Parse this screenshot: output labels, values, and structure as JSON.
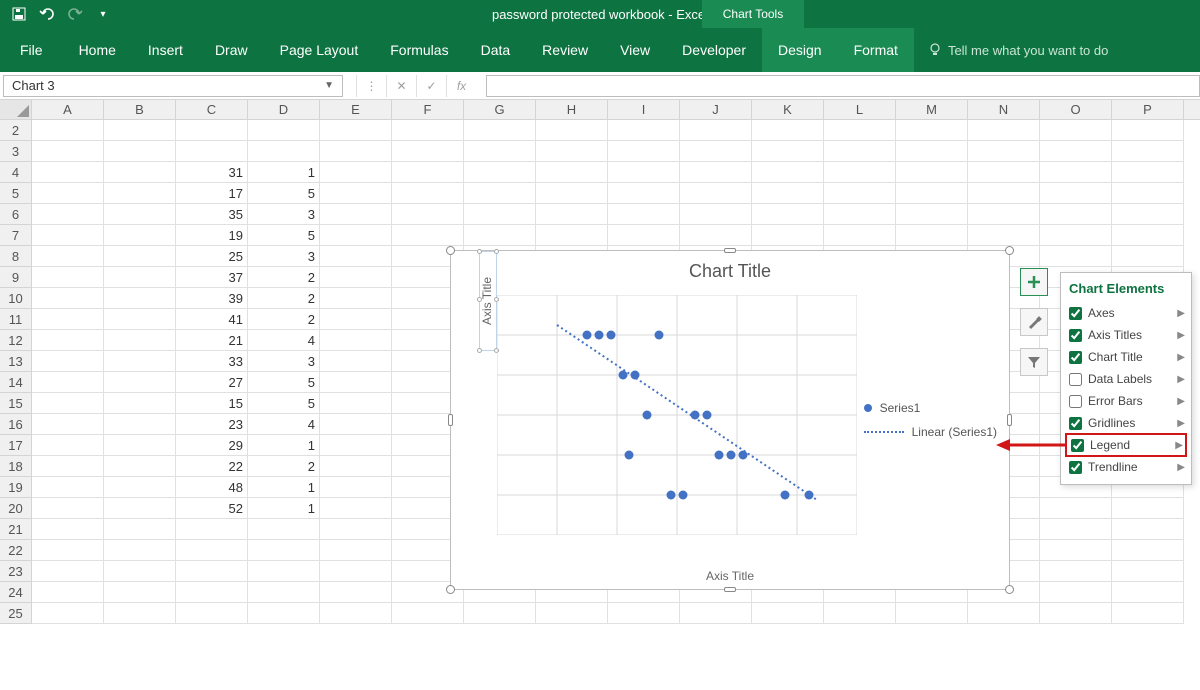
{
  "app": {
    "title": "password protected workbook  -  Excel",
    "context_tab": "Chart Tools"
  },
  "qat": {
    "save": "save-icon",
    "undo": "undo-icon",
    "redo": "redo-icon",
    "custom": "customize-icon"
  },
  "ribbon": {
    "tabs": [
      "File",
      "Home",
      "Insert",
      "Draw",
      "Page Layout",
      "Formulas",
      "Data",
      "Review",
      "View",
      "Developer",
      "Design",
      "Format"
    ],
    "active": [
      "Design",
      "Format"
    ],
    "tell_me": "Tell me what you want to do"
  },
  "fx": {
    "name_box": "Chart 3",
    "cancel": "✕",
    "enter": "✓",
    "fx": "fx",
    "formula": ""
  },
  "sheet": {
    "cols": [
      "A",
      "B",
      "C",
      "D",
      "E",
      "F",
      "G",
      "H",
      "I",
      "J",
      "K",
      "L",
      "M",
      "N",
      "O",
      "P"
    ],
    "rows": [
      {
        "n": 2,
        "C": "",
        "D": ""
      },
      {
        "n": 3,
        "C": "",
        "D": ""
      },
      {
        "n": 4,
        "C": "31",
        "D": "1"
      },
      {
        "n": 5,
        "C": "17",
        "D": "5"
      },
      {
        "n": 6,
        "C": "35",
        "D": "3"
      },
      {
        "n": 7,
        "C": "19",
        "D": "5"
      },
      {
        "n": 8,
        "C": "25",
        "D": "3"
      },
      {
        "n": 9,
        "C": "37",
        "D": "2"
      },
      {
        "n": 10,
        "C": "39",
        "D": "2"
      },
      {
        "n": 11,
        "C": "41",
        "D": "2"
      },
      {
        "n": 12,
        "C": "21",
        "D": "4"
      },
      {
        "n": 13,
        "C": "33",
        "D": "3"
      },
      {
        "n": 14,
        "C": "27",
        "D": "5"
      },
      {
        "n": 15,
        "C": "15",
        "D": "5"
      },
      {
        "n": 16,
        "C": "23",
        "D": "4"
      },
      {
        "n": 17,
        "C": "29",
        "D": "1"
      },
      {
        "n": 18,
        "C": "22",
        "D": "2"
      },
      {
        "n": 19,
        "C": "48",
        "D": "1"
      },
      {
        "n": 20,
        "C": "52",
        "D": "1"
      },
      {
        "n": 21,
        "C": "",
        "D": ""
      },
      {
        "n": 22,
        "C": "",
        "D": ""
      },
      {
        "n": 23,
        "C": "",
        "D": ""
      },
      {
        "n": 24,
        "C": "",
        "D": ""
      },
      {
        "n": 25,
        "C": "",
        "D": ""
      }
    ]
  },
  "chart_elements_panel": {
    "title": "Chart Elements",
    "options": [
      {
        "label": "Axes",
        "checked": true
      },
      {
        "label": "Axis Titles",
        "checked": true
      },
      {
        "label": "Chart Title",
        "checked": true
      },
      {
        "label": "Data Labels",
        "checked": false
      },
      {
        "label": "Error Bars",
        "checked": false
      },
      {
        "label": "Gridlines",
        "checked": true
      },
      {
        "label": "Legend",
        "checked": true,
        "highlight": true
      },
      {
        "label": "Trendline",
        "checked": true
      }
    ]
  },
  "chart_data": {
    "type": "scatter",
    "title": "Chart Title",
    "xlabel": "Axis Title",
    "ylabel": "Axis Title",
    "xlim": [
      0,
      60
    ],
    "ylim": [
      0,
      6
    ],
    "x_ticks": [
      0,
      10,
      20,
      30,
      40,
      50,
      60
    ],
    "y_ticks": [
      0,
      1,
      2,
      3,
      4,
      5,
      6
    ],
    "series": [
      {
        "name": "Series1",
        "points": [
          [
            31,
            1
          ],
          [
            17,
            5
          ],
          [
            35,
            3
          ],
          [
            19,
            5
          ],
          [
            25,
            3
          ],
          [
            37,
            2
          ],
          [
            39,
            2
          ],
          [
            41,
            2
          ],
          [
            21,
            4
          ],
          [
            33,
            3
          ],
          [
            27,
            5
          ],
          [
            15,
            5
          ],
          [
            23,
            4
          ],
          [
            29,
            1
          ],
          [
            22,
            2
          ],
          [
            48,
            1
          ],
          [
            52,
            1
          ]
        ]
      }
    ],
    "trendline": {
      "name": "Linear (Series1)",
      "style": "dotted"
    },
    "legend": [
      "Series1",
      "Linear (Series1)"
    ],
    "grid": true
  }
}
